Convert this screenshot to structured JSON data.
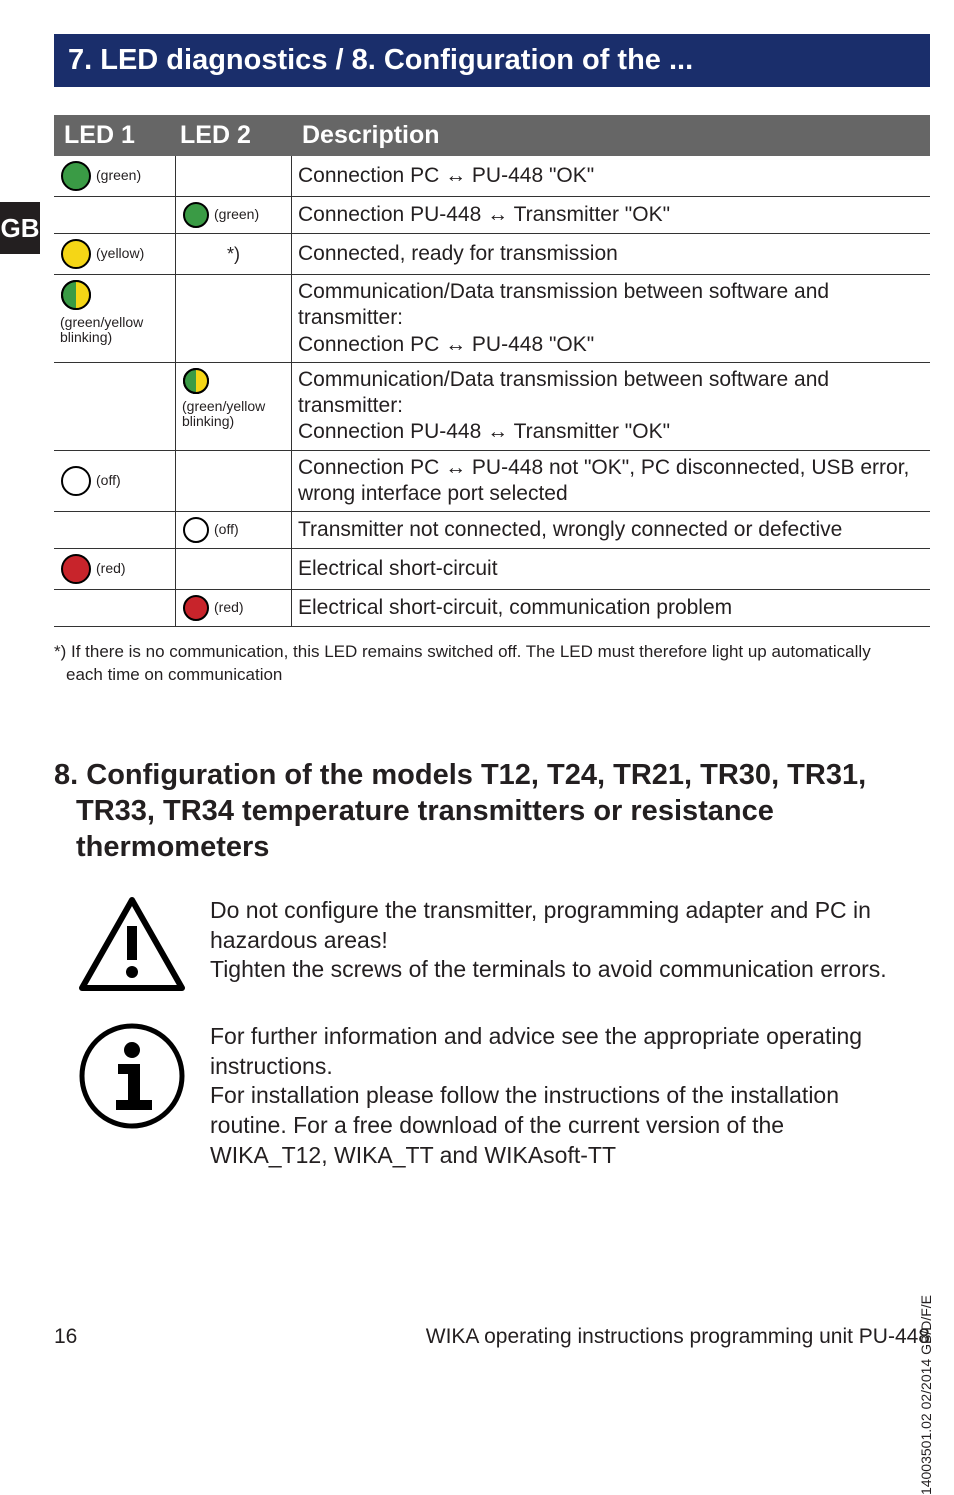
{
  "header": "7. LED diagnostics / 8. Configuration of the ...",
  "lang": "GB",
  "table": {
    "headers": {
      "c1": "LED 1",
      "c2": "LED 2",
      "c3": "Description"
    },
    "rows": [
      {
        "led1": {
          "color": "green",
          "blink": false,
          "label": "(green)"
        },
        "led2": null,
        "desc": "Connection PC ↔ PU-448 \"OK\""
      },
      {
        "led1": null,
        "led2": {
          "color": "green",
          "blink": false,
          "label": "(green)"
        },
        "desc": "Connection PU-448 ↔ Transmitter \"OK\""
      },
      {
        "led1": {
          "color": "yellow",
          "blink": false,
          "label": "(yellow)"
        },
        "led2_text": "*)",
        "desc": "Connected, ready for transmission"
      },
      {
        "led1": {
          "color": "green",
          "blink": true,
          "label": "(green/yellow blinking)"
        },
        "led2": null,
        "desc": "Communication/Data transmission between software and transmitter:\nConnection PC ↔ PU-448 \"OK\""
      },
      {
        "led1": null,
        "led2": {
          "color": "green",
          "blink": true,
          "label": "(green/yellow blinking)"
        },
        "desc": "Communication/Data transmission between software and transmitter:\nConnection PU-448 ↔ Transmitter \"OK\""
      },
      {
        "led1": {
          "color": "off",
          "blink": false,
          "label": "(off)"
        },
        "led2": null,
        "desc": "Connection PC ↔ PU-448 not \"OK\", PC disconnected, USB error, wrong interface port selected"
      },
      {
        "led1": null,
        "led2": {
          "color": "off",
          "blink": false,
          "label": "(off)"
        },
        "desc": "Transmitter not connected, wrongly connected or defective"
      },
      {
        "led1": {
          "color": "red",
          "blink": false,
          "label": "(red)"
        },
        "led2": null,
        "desc": "Electrical short-circuit"
      },
      {
        "led1": null,
        "led2": {
          "color": "red",
          "blink": false,
          "label": "(red)"
        },
        "desc": "Electrical short-circuit, communication problem"
      }
    ]
  },
  "footnote": "*) If there is no communication, this LED remains switched off. The LED must therefore light up automatically each time on communication",
  "section8": {
    "num": "8.",
    "title": "Configuration of the models T12, T24, TR21, TR30, TR31, TR33, TR34 temperature transmitters or resistance thermometers"
  },
  "warning_text": "Do not configure the transmitter, programming adapter and PC in hazardous areas!\nTighten the screws of the terminals to avoid communication errors.",
  "info_text": "For further information and advice see the appropriate operating instructions.\nFor installation please follow the instructions of the installation routine. For a free download of the current version of the WIKA_T12, WIKA_TT and WIKAsoft-TT",
  "side_vertical": "14003501.02 02/2014 GB/D/F/E",
  "footer": {
    "page": "16",
    "title": "WIKA operating instructions programming unit PU-448"
  },
  "led_colors": {
    "green": "#3a9b45",
    "yellow": "#f5d616",
    "red": "#c8242b",
    "off": "#ffffff"
  }
}
